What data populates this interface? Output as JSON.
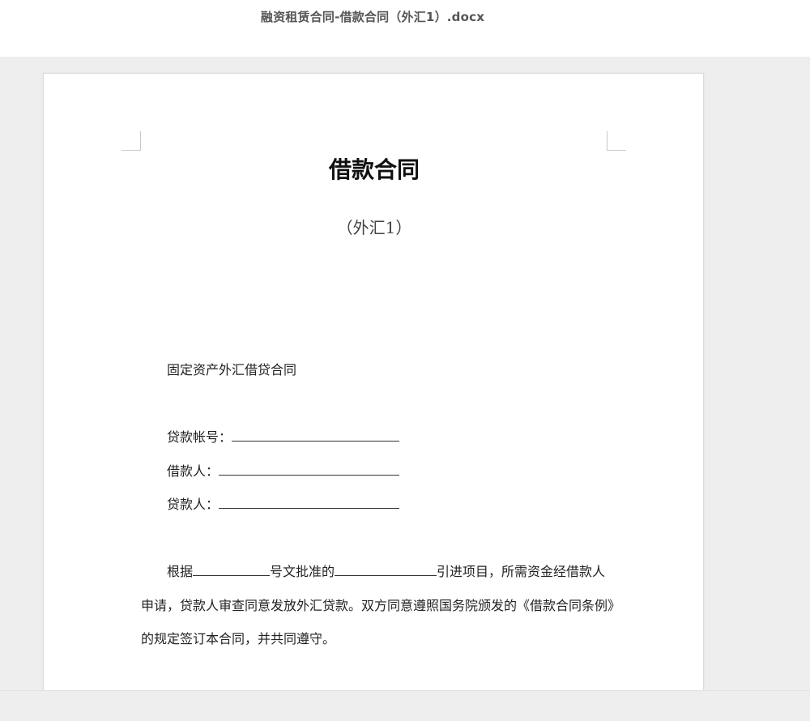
{
  "header": {
    "file_title": "融资租赁合同-借款合同（外汇1）.docx"
  },
  "document": {
    "heading": "借款合同",
    "subheading": "（外汇1）",
    "contract_type": "固定资产外汇借贷合同",
    "fields": [
      {
        "label": "贷款帐号："
      },
      {
        "label": "借款人："
      },
      {
        "label": "贷款人："
      }
    ],
    "paragraph": {
      "p1_a": "根据",
      "p1_b": "号文批准的",
      "p1_c": "引进项目，所需资金经借款人",
      "p2": "申请，贷款人审查同意发放外汇贷款。双方同意遵照国务院颁发的《借款合同条例》",
      "p3": "的规定签订本合同，并共同遵守。"
    }
  }
}
